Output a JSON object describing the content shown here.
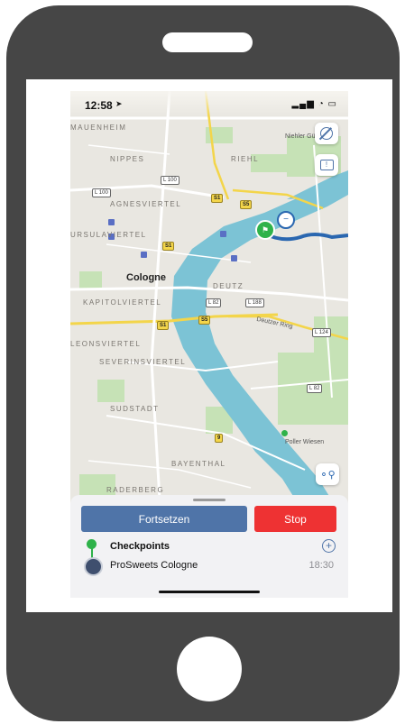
{
  "status_bar": {
    "time": "12:58",
    "icons": "▂▄▆ ◔ ▭"
  },
  "map": {
    "city": "Cologne",
    "districts": [
      "MAUENHEIM",
      "NIPPES",
      "RIEHL",
      "AGNESVIERTEL",
      "URSULAVIERTEL",
      "KAPITOLVIERTEL",
      "DEUTZ",
      "LEONSVIERTEL",
      "SEVERINSVIERTEL",
      "SUDSTADT",
      "BAYENTHAL",
      "RADERBERG"
    ],
    "streets": [
      "Niehler Gürtel",
      "Deutzer Ring",
      "Poller Wiesen"
    ],
    "road_shields": {
      "yellow": [
        "S1",
        "S5",
        "S1",
        "S1",
        "S5",
        "9"
      ],
      "white": [
        "L 100",
        "L 100",
        "L 82",
        "L 188",
        "L 124",
        "L 82"
      ]
    },
    "map_buttons": [
      "settings-icon",
      "feedback-icon",
      "waypoints-icon"
    ]
  },
  "sheet": {
    "primary_button": "Fortsetzen",
    "stop_button": "Stop",
    "checkpoints_title": "Checkpoints",
    "items": [
      {
        "name": "ProSweets Cologne",
        "time": "18:30"
      }
    ]
  },
  "colors": {
    "primary": "#4f74a8",
    "stop": "#ee3233",
    "river": "#7cc3d5",
    "route": "#2a67b0",
    "frame": "#464646",
    "checkpoint": "#2fb24a"
  }
}
